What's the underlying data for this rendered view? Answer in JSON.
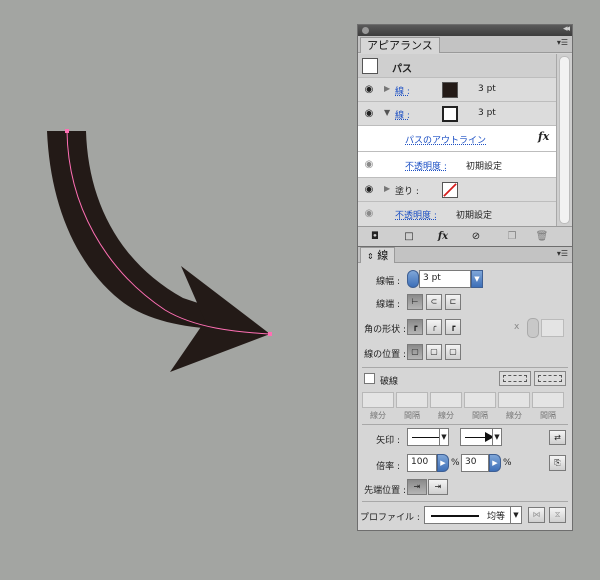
{
  "appearance_panel": {
    "tab_title": "アピアランス",
    "object_label": "パス",
    "rows": [
      {
        "label": "線 :",
        "value": "3 pt",
        "swatch_color": "#231a17"
      },
      {
        "label": "線 :",
        "value": "3 pt",
        "swatch_color": "#ffffff"
      },
      {
        "label": "パスのアウトライン",
        "fx": "fx"
      },
      {
        "label": "不透明度 :",
        "value": "初期設定"
      },
      {
        "label": "塗り :"
      },
      {
        "label": "不透明度 :",
        "value": "初期設定"
      }
    ]
  },
  "stroke_panel": {
    "tab_title": "線",
    "weight_label": "線幅 :",
    "weight_value": "3 pt",
    "cap_label": "線端 :",
    "corner_label": "角の形状 :",
    "miter_prefix": "x",
    "align_label": "線の位置 :",
    "dashed_label": "破線",
    "dash_labels": [
      "線分",
      "間隔",
      "線分",
      "間隔",
      "線分",
      "間隔"
    ],
    "arrow_label": "矢印 :",
    "scale_label": "倍率 :",
    "scale_start": "100",
    "scale_end": "30",
    "percent": "%",
    "align_tip_label": "先端位置 :",
    "profile_label": "プロファイル :",
    "profile_value": "均等"
  },
  "colors": {
    "artwork": "#231a17",
    "path_highlight": "#ff6fb4",
    "link": "#1b4fc4",
    "background": "#a3a5a2"
  }
}
